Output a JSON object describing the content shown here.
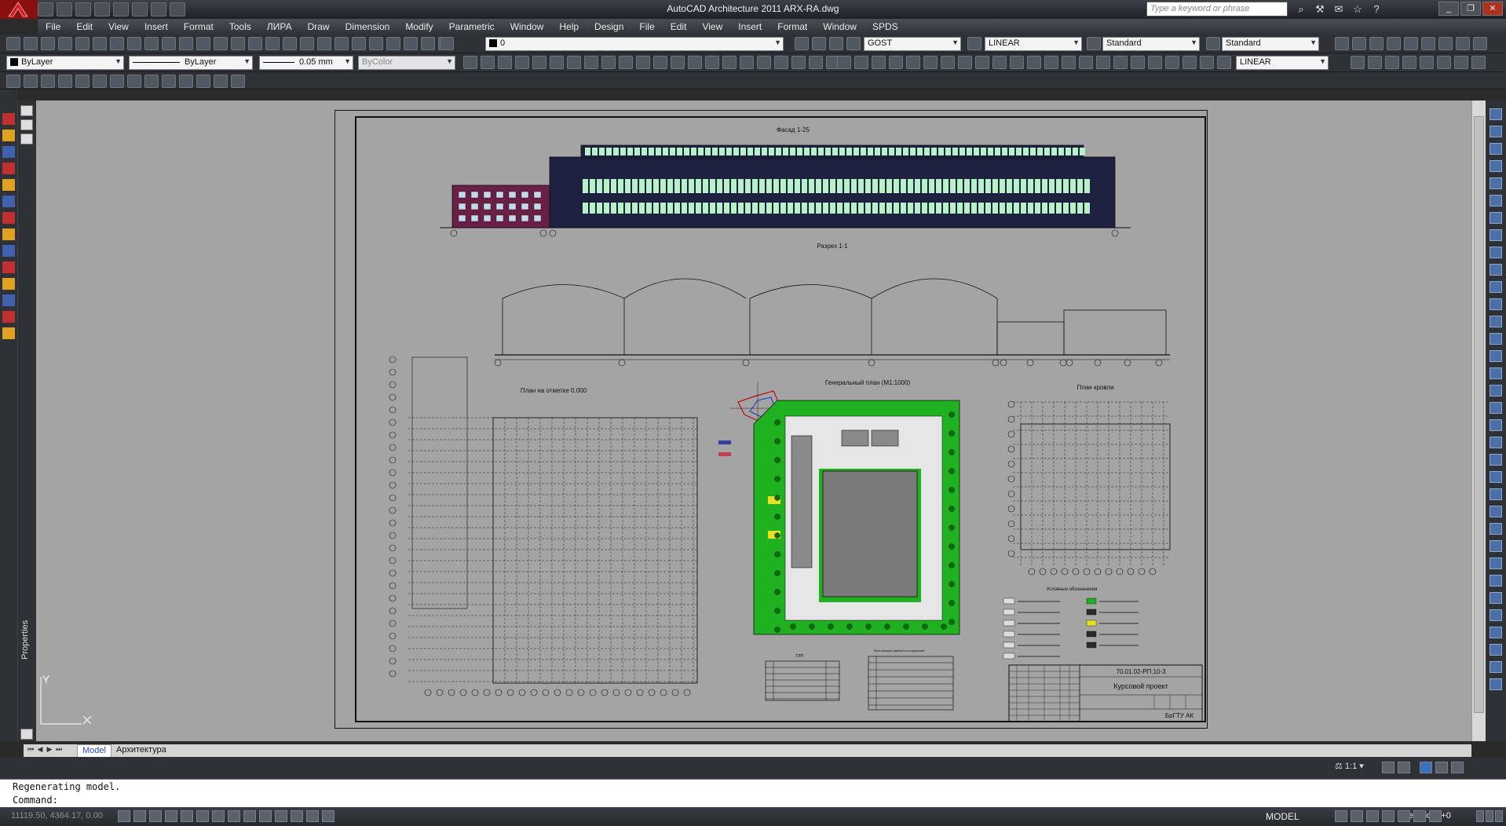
{
  "window": {
    "title": "AutoCAD Architecture 2011    ARX-RA.dwg",
    "search_placeholder": "Type a keyword or phrase"
  },
  "menu": {
    "items": [
      "File",
      "Edit",
      "View",
      "Insert",
      "Format",
      "Tools",
      "ЛИРА",
      "Draw",
      "Dimension",
      "Modify",
      "Parametric",
      "Window",
      "Help",
      "Design",
      "File",
      "Edit",
      "View",
      "Insert",
      "Format",
      "Window",
      "SPDS"
    ]
  },
  "toolbar": {
    "layer_value": "0",
    "text_style": "GOST",
    "dim_style": "LINEAR",
    "table_style": "Standard",
    "multileader_style": "Standard",
    "color": "ByLayer",
    "linetype": "ByLayer",
    "lineweight": "0.05 mm",
    "plot_style": "ByColor",
    "dim_style_2": "LINEAR"
  },
  "drawing": {
    "facade_title": "Фасад 1-25",
    "section_title": "Разрез 1-1",
    "floor_plan_title": "План на отметке 0.000",
    "site_plan_title": "Генеральный план (М1:1000)",
    "roof_plan_title": "План кровли",
    "legend_title": "Условные обозначения",
    "teps_title": "ТЭП",
    "explication_title": "Экспликация зданий и сооружений",
    "title_block_code": "70.01.02-РП.10-3",
    "title_block_name": "Курсовой проект",
    "title_block_org": "БрГТУ  АК"
  },
  "tabs": {
    "model": "Model",
    "layout": "Архитектура"
  },
  "command": {
    "line1": "Regenerating model.",
    "line2": "Command:"
  },
  "status": {
    "coords": "11119.50, 4364.17, 0.00",
    "space": "MODEL",
    "annotation_scale": "1:1",
    "elevation": "Elevation: +0"
  },
  "ucs": {
    "y_label": "Y",
    "properties_label": "Properties"
  }
}
